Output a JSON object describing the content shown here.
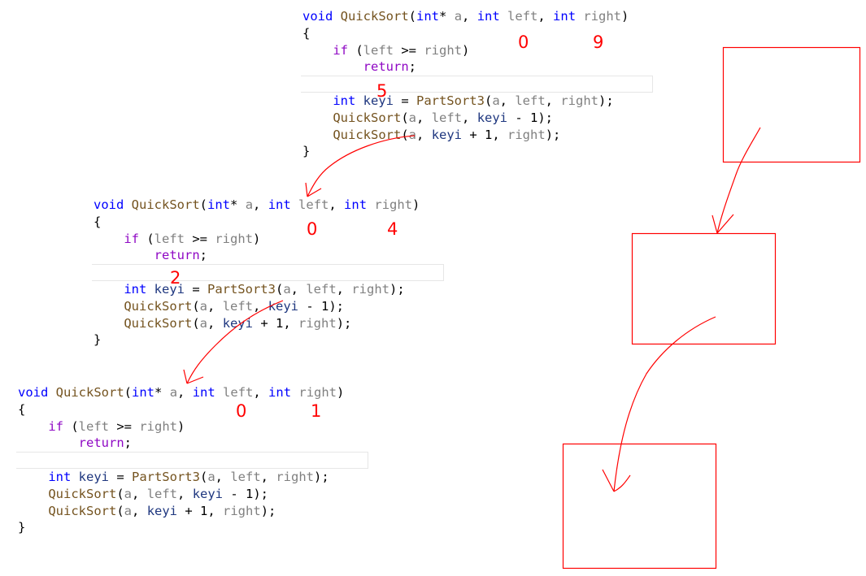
{
  "code_lines": [
    [
      [
        "kw",
        "void "
      ],
      [
        "fn",
        "QuickSort"
      ],
      [
        "pl",
        "("
      ],
      [
        "kw",
        "int"
      ],
      [
        "pl",
        "* "
      ],
      [
        "pm",
        "a"
      ],
      [
        "pl",
        ", "
      ],
      [
        "kw",
        "int "
      ],
      [
        "pm",
        "left"
      ],
      [
        "pl",
        ", "
      ],
      [
        "kw",
        "int "
      ],
      [
        "pm",
        "right"
      ],
      [
        "pl",
        ")"
      ]
    ],
    [
      [
        "pl",
        "{"
      ]
    ],
    [
      [
        "pl",
        "    "
      ],
      [
        "ctl",
        "if"
      ],
      [
        "pl",
        " ("
      ],
      [
        "pm",
        "left"
      ],
      [
        "pl",
        " >= "
      ],
      [
        "pm",
        "right"
      ],
      [
        "pl",
        ")"
      ]
    ],
    [
      [
        "pl",
        "        "
      ],
      [
        "ctl",
        "return"
      ],
      [
        "pl",
        ";"
      ]
    ],
    [],
    [
      [
        "pl",
        "    "
      ],
      [
        "kw",
        "int "
      ],
      [
        "lv",
        "keyi"
      ],
      [
        "pl",
        " = "
      ],
      [
        "fn",
        "PartSort3"
      ],
      [
        "pl",
        "("
      ],
      [
        "pm",
        "a"
      ],
      [
        "pl",
        ", "
      ],
      [
        "pm",
        "left"
      ],
      [
        "pl",
        ", "
      ],
      [
        "pm",
        "right"
      ],
      [
        "pl",
        ");"
      ]
    ],
    [
      [
        "pl",
        "    "
      ],
      [
        "fn",
        "QuickSort"
      ],
      [
        "pl",
        "("
      ],
      [
        "pm",
        "a"
      ],
      [
        "pl",
        ", "
      ],
      [
        "pm",
        "left"
      ],
      [
        "pl",
        ", "
      ],
      [
        "lv",
        "keyi"
      ],
      [
        "pl",
        " - 1);"
      ]
    ],
    [
      [
        "pl",
        "    "
      ],
      [
        "fn",
        "QuickSort"
      ],
      [
        "pl",
        "("
      ],
      [
        "pm",
        "a"
      ],
      [
        "pl",
        ", "
      ],
      [
        "lv",
        "keyi"
      ],
      [
        "pl",
        " + 1, "
      ],
      [
        "pm",
        "right"
      ],
      [
        "pl",
        ");"
      ]
    ],
    [
      [
        "pl",
        "}"
      ]
    ]
  ],
  "syntax_colors": {
    "keyword": "#0000ff",
    "function": "#74531f",
    "parameter": "#808080",
    "local": "#1f377f",
    "control": "#8f08c4"
  },
  "annotation_color": "#ff0000",
  "blocks": [
    {
      "left_value": "0",
      "right_value": "9",
      "keyi_value": "5"
    },
    {
      "left_value": "0",
      "right_value": "4",
      "keyi_value": "2"
    },
    {
      "left_value": "0",
      "right_value": "1"
    }
  ]
}
